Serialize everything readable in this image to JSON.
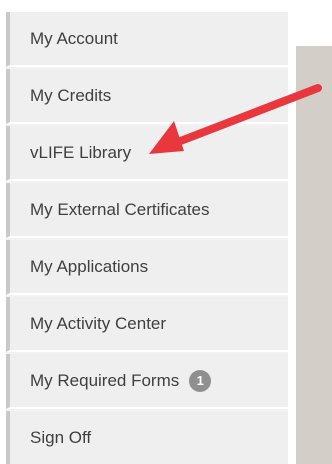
{
  "menu": {
    "items": [
      {
        "label": "My Account"
      },
      {
        "label": "My Credits"
      },
      {
        "label": "vLIFE Library"
      },
      {
        "label": "My External Certificates"
      },
      {
        "label": "My Applications"
      },
      {
        "label": "My Activity Center"
      },
      {
        "label": "My Required Forms",
        "badge": "1"
      },
      {
        "label": "Sign Off"
      }
    ]
  },
  "colors": {
    "arrow": "#e8383d",
    "menu_bg": "#efefef",
    "menu_border": "#c9c9c9",
    "text": "#3f3f3f",
    "badge_bg": "#8f8f8f",
    "panel": "#d4cec8"
  },
  "icons": {
    "arrow": "red-arrow-icon"
  }
}
